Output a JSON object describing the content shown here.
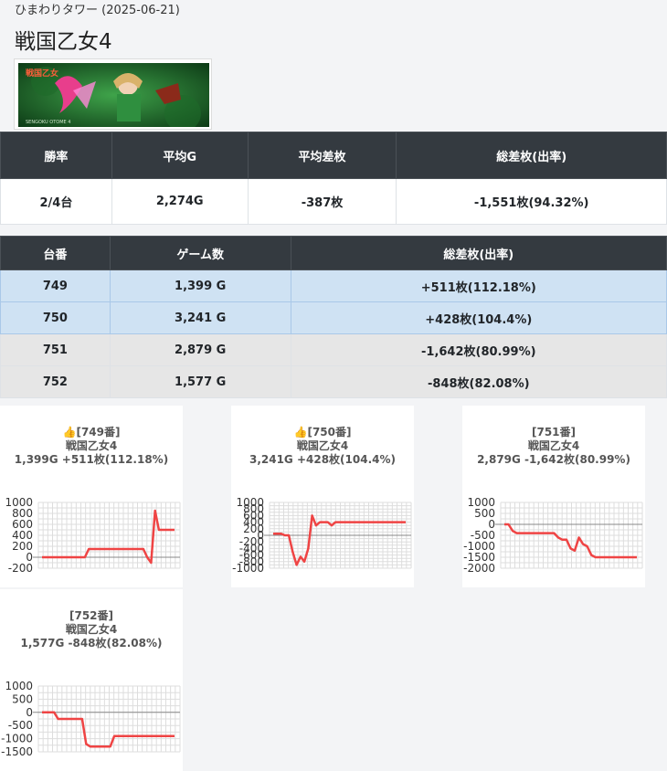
{
  "header": {
    "store_date": "ひまわりタワー (2025-06-21)",
    "machine_title": "戦国乙女4"
  },
  "banner": {
    "description_icon": "machine-banner-image"
  },
  "summary": {
    "headers": [
      "勝率",
      "平均G",
      "平均差枚",
      "総差枚(出率)"
    ],
    "values": [
      "2/4台",
      "2,274G",
      "-387枚",
      "-1,551枚(94.32%)"
    ]
  },
  "machines": {
    "headers": [
      "台番",
      "ゲーム数",
      "総差枚(出率)"
    ],
    "rows": [
      {
        "no": "749",
        "games": "1,399 G",
        "diff": "+511枚(112.18%)",
        "positive": true
      },
      {
        "no": "750",
        "games": "3,241 G",
        "diff": "+428枚(104.4%)",
        "positive": true
      },
      {
        "no": "751",
        "games": "2,879 G",
        "diff": "-1,642枚(80.99%)",
        "positive": false
      },
      {
        "no": "752",
        "games": "1,577 G",
        "diff": "-848枚(82.08%)",
        "positive": false
      }
    ]
  },
  "colors": {
    "header_bg": "#343a40",
    "win_row": "#cfe2f3",
    "lose_row": "#e6e6e6",
    "line": "#ef4444"
  },
  "chart_data": [
    {
      "type": "line",
      "thumb": "👍",
      "title_no": "[749番]",
      "title_name": "戦国乙女4",
      "title_stats": "1,399G +511枚(112.18%)",
      "yticks": [
        1000,
        800,
        600,
        400,
        200,
        0,
        -200
      ],
      "ylim": [
        -200,
        1000
      ],
      "values": [
        0,
        0,
        0,
        0,
        0,
        0,
        0,
        0,
        0,
        0,
        0,
        0,
        150,
        150,
        150,
        150,
        150,
        150,
        150,
        150,
        150,
        150,
        150,
        150,
        150,
        150,
        150,
        0,
        -100,
        850,
        500,
        500,
        500,
        500,
        500
      ]
    },
    {
      "type": "line",
      "thumb": "👍",
      "title_no": "[750番]",
      "title_name": "戦国乙女4",
      "title_stats": "3,241G +428枚(104.4%)",
      "yticks": [
        1000,
        800,
        600,
        400,
        200,
        0,
        -200,
        -400,
        -600,
        -800,
        -1000
      ],
      "ylim": [
        -1000,
        1000
      ],
      "values": [
        50,
        50,
        50,
        0,
        0,
        -500,
        -900,
        -650,
        -800,
        -400,
        600,
        300,
        400,
        400,
        400,
        300,
        400,
        400,
        400,
        400,
        400,
        400,
        400,
        400,
        400,
        400,
        400,
        400,
        400,
        400,
        400,
        400,
        400,
        400,
        400
      ]
    },
    {
      "type": "line",
      "thumb": "",
      "title_no": "[751番]",
      "title_name": "戦国乙女4",
      "title_stats": "2,879G -1,642枚(80.99%)",
      "yticks": [
        1000,
        500,
        0,
        -500,
        -1000,
        -1500,
        -2000
      ],
      "ylim": [
        -2000,
        1000
      ],
      "values": [
        0,
        0,
        -300,
        -400,
        -400,
        -400,
        -400,
        -400,
        -400,
        -400,
        -400,
        -400,
        -400,
        -600,
        -700,
        -700,
        -1100,
        -1200,
        -600,
        -900,
        -1000,
        -1400,
        -1500,
        -1500,
        -1500,
        -1500,
        -1500,
        -1500,
        -1500,
        -1500,
        -1500,
        -1500,
        -1500
      ]
    },
    {
      "type": "line",
      "thumb": "",
      "title_no": "[752番]",
      "title_name": "戦国乙女4",
      "title_stats": "1,577G -848枚(82.08%)",
      "yticks": [
        1000,
        500,
        0,
        -500,
        -1000,
        -1500
      ],
      "ylim": [
        -1500,
        1000
      ],
      "values": [
        0,
        0,
        0,
        0,
        -250,
        -250,
        -250,
        -250,
        -250,
        -250,
        -250,
        -1200,
        -1300,
        -1300,
        -1300,
        -1300,
        -1300,
        -1300,
        -900,
        -900,
        -900,
        -900,
        -900,
        -900,
        -900,
        -900,
        -900,
        -900,
        -900,
        -900,
        -900,
        -900,
        -900,
        -900
      ]
    }
  ]
}
